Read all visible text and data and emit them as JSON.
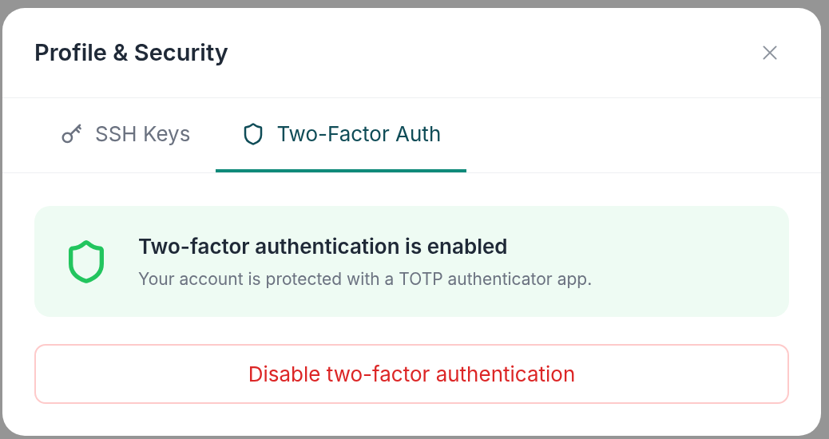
{
  "dialog": {
    "title": "Profile & Security"
  },
  "tabs": [
    {
      "label": "SSH Keys",
      "selected": false
    },
    {
      "label": "Two-Factor Auth",
      "selected": true
    }
  ],
  "status": {
    "title": "Two-factor authentication is enabled",
    "description": "Your account is protected with a TOTP authenticator app."
  },
  "action_button": "Disable two-factor authentication"
}
